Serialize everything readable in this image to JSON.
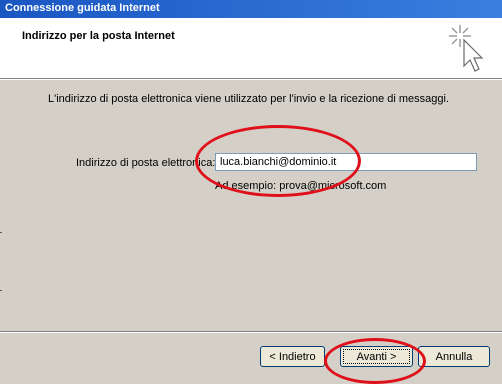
{
  "window": {
    "title": "Connessione guidata Internet"
  },
  "header": {
    "title": "Indirizzo per la posta Internet",
    "icon": "wizard-wand-icon"
  },
  "content": {
    "description": "L'indirizzo di posta elettronica viene utilizzato per l'invio e la ricezione di messaggi.",
    "email_label": "Indirizzo di posta elettronica:",
    "email_value": "luca.bianchi@dominio.it",
    "example_text": "Ad esempio: prova@microsoft.com"
  },
  "buttons": {
    "back": "< Indietro",
    "next": "Avanti >",
    "cancel": "Annulla"
  },
  "colors": {
    "titlebar": "#2a6fd6",
    "highlight": "#e0101a",
    "dialog_bg": "#d4d0c8"
  }
}
